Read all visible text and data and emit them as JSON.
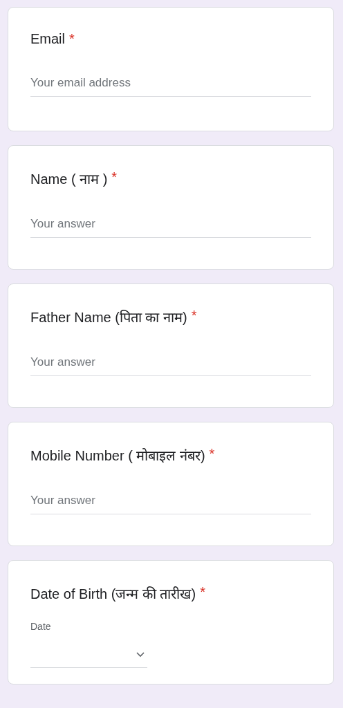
{
  "questions": [
    {
      "kind": "text",
      "label": "Email",
      "required": true,
      "required_mark": "*",
      "placeholder": "Your email address"
    },
    {
      "kind": "text",
      "label": "Name ( नाम )",
      "required": true,
      "required_mark": "*",
      "placeholder": "Your answer"
    },
    {
      "kind": "text",
      "label": "Father Name (पिता का नाम)",
      "required": true,
      "required_mark": "*",
      "placeholder": "Your answer"
    },
    {
      "kind": "text",
      "label": "Mobile Number ( मोबाइल नंबर)",
      "required": true,
      "required_mark": "*",
      "placeholder": "Your answer"
    },
    {
      "kind": "date",
      "label": "Date of Birth (जन्म की तारीख)",
      "required": true,
      "required_mark": "*",
      "field_label": "Date"
    }
  ]
}
